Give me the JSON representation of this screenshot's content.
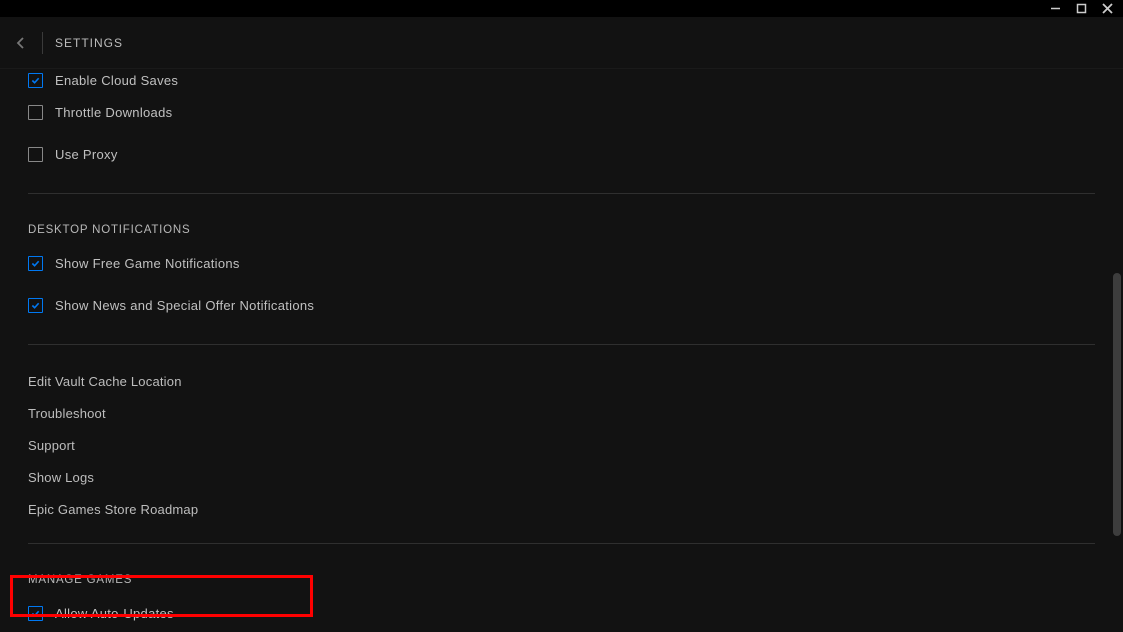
{
  "window": {
    "minimize": "minimize",
    "maximize": "maximize",
    "close": "close"
  },
  "header": {
    "back": "back",
    "title": "SETTINGS"
  },
  "top_options": [
    {
      "label": "Enable Cloud Saves",
      "checked": true,
      "cutoff": true
    },
    {
      "label": "Throttle Downloads",
      "checked": false
    },
    {
      "label": "Use Proxy",
      "checked": false
    }
  ],
  "sections": {
    "notifications": {
      "title": "DESKTOP NOTIFICATIONS",
      "items": [
        {
          "label": "Show Free Game Notifications",
          "checked": true
        },
        {
          "label": "Show News and Special Offer Notifications",
          "checked": true
        }
      ]
    },
    "links": [
      {
        "label": "Edit Vault Cache Location"
      },
      {
        "label": "Troubleshoot"
      },
      {
        "label": "Support"
      },
      {
        "label": "Show Logs"
      },
      {
        "label": "Epic Games Store Roadmap"
      }
    ],
    "manage_games": {
      "title": "MANAGE GAMES",
      "items": [
        {
          "label": "Allow Auto-Updates",
          "checked": true
        }
      ]
    }
  }
}
